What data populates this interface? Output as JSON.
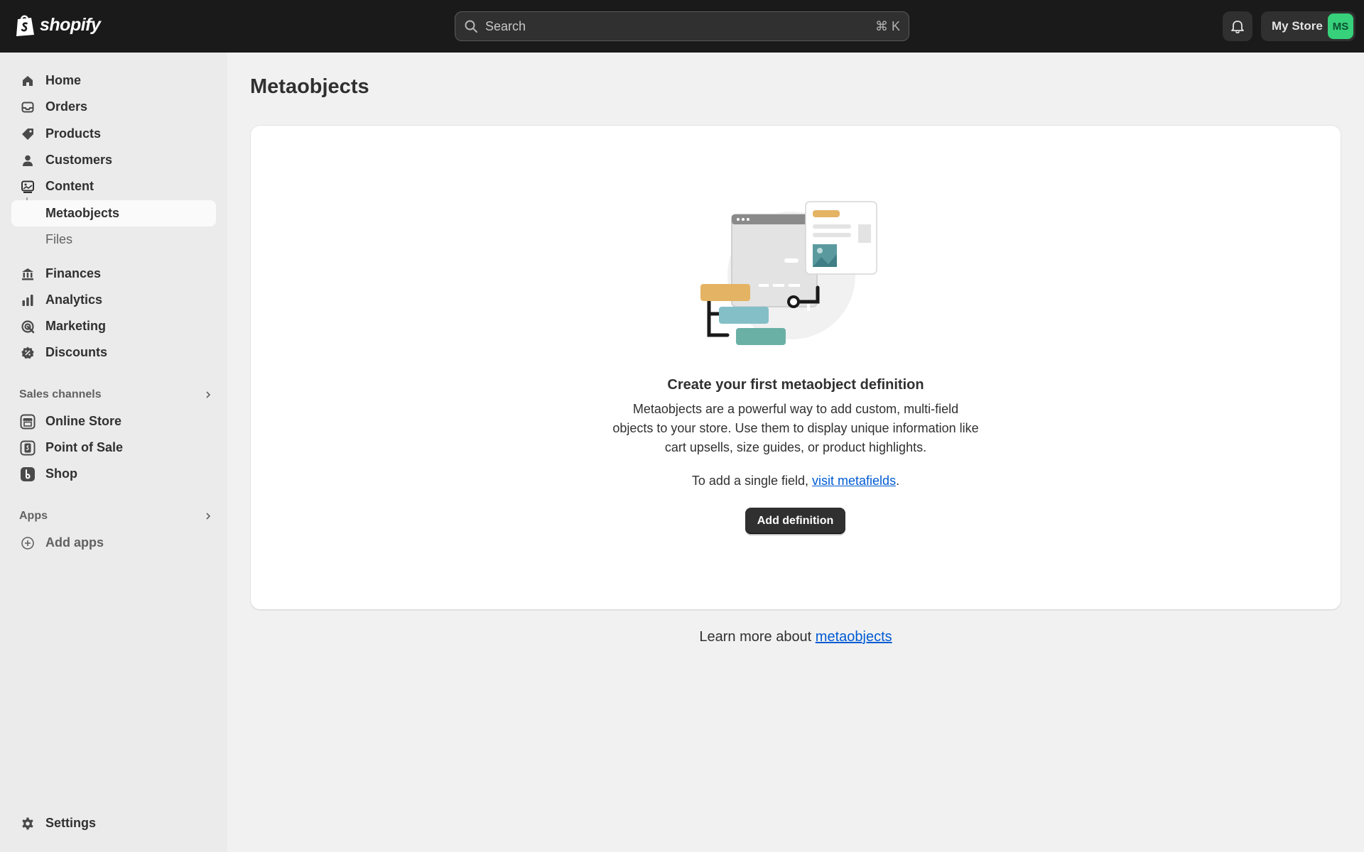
{
  "topbar": {
    "logo_text": "shopify",
    "search": {
      "placeholder": "Search",
      "shortcut": "⌘ K"
    },
    "store": {
      "name": "My Store",
      "initials": "MS",
      "avatar_color": "#36d17a"
    }
  },
  "sidebar": {
    "items": [
      {
        "label": "Home",
        "icon": "home-icon"
      },
      {
        "label": "Orders",
        "icon": "inbox-icon"
      },
      {
        "label": "Products",
        "icon": "tag-icon"
      },
      {
        "label": "Customers",
        "icon": "person-icon"
      },
      {
        "label": "Content",
        "icon": "content-icon"
      },
      {
        "label": "Metaobjects",
        "active": true
      },
      {
        "label": "Files"
      },
      {
        "label": "Finances",
        "icon": "bank-icon"
      },
      {
        "label": "Analytics",
        "icon": "chart-icon"
      },
      {
        "label": "Marketing",
        "icon": "target-icon"
      },
      {
        "label": "Discounts",
        "icon": "discount-icon"
      }
    ],
    "sales_channels": {
      "heading": "Sales channels",
      "items": [
        {
          "label": "Online Store",
          "icon": "store-icon"
        },
        {
          "label": "Point of Sale",
          "icon": "pos-icon"
        },
        {
          "label": "Shop",
          "icon": "shop-icon"
        }
      ]
    },
    "apps": {
      "heading": "Apps",
      "items": [
        {
          "label": "Add apps",
          "icon": "add-circle-icon"
        }
      ]
    },
    "settings": {
      "label": "Settings",
      "icon": "gear-icon"
    }
  },
  "main": {
    "title": "Metaobjects",
    "empty_state": {
      "heading": "Create your first metaobject definition",
      "body": "Metaobjects are a powerful way to add custom, multi-field objects to your store. Use them to display unique information like cart upsells, size guides, or product highlights.",
      "single_field_prefix": "To add a single field, ",
      "single_field_link": "visit metafields",
      "single_field_suffix": ".",
      "button_label": "Add definition"
    },
    "learn_more": {
      "prefix": "Learn more about ",
      "link": "metaobjects"
    }
  },
  "colors": {
    "topbar": "#1a1a1a",
    "sidebar": "#ebebeb",
    "background": "#f1f1f1",
    "link": "#005bd3",
    "primary_button": "#303030"
  }
}
